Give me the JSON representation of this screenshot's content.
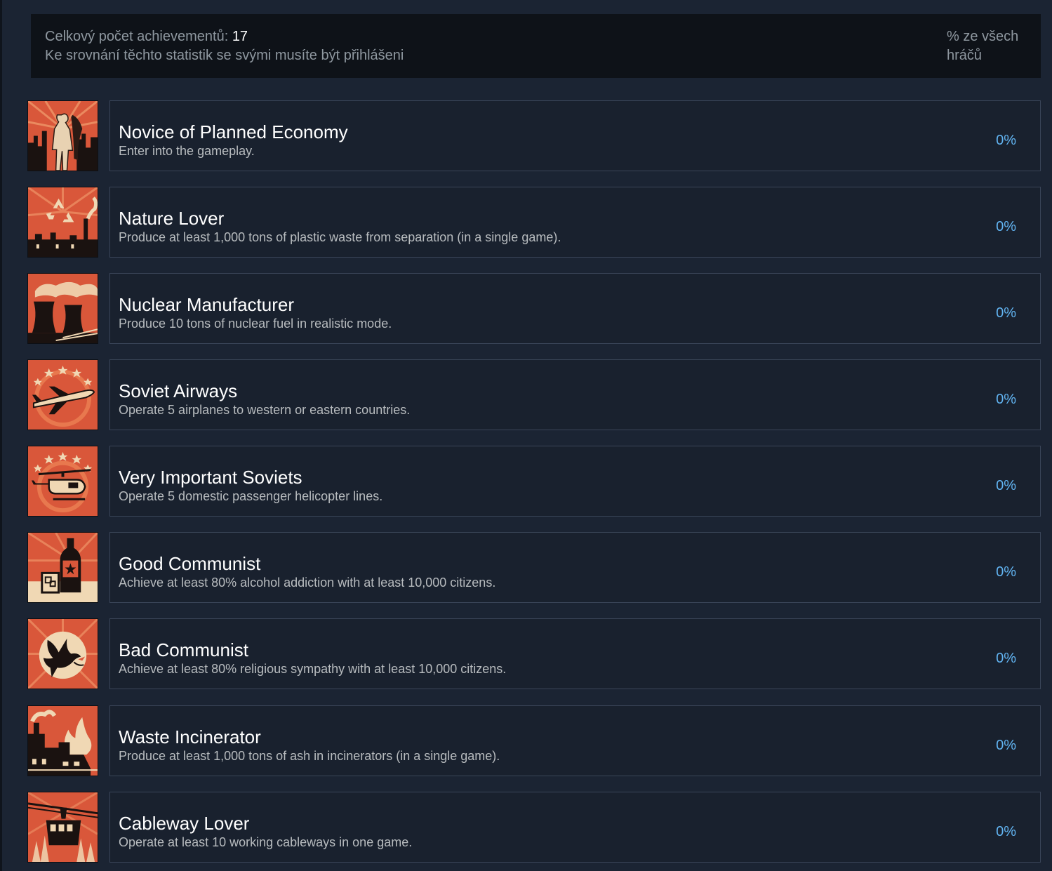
{
  "header": {
    "total_label": "Celkový počet achievementů:",
    "total_count": "17",
    "login_note": "Ke srovnání těchto statistik se svými musíte být přihlášeni",
    "percent_label_1": "% ze všech",
    "percent_label_2": "hráčů"
  },
  "colors": {
    "background": "#1b2433",
    "header_bg": "#0e1218",
    "panel_border": "#3a4558",
    "percent_text": "#62b5f3",
    "icon_orange": "#d9573a",
    "icon_cream": "#f0d8b4"
  },
  "achievements": [
    {
      "title": "Novice of Planned Economy",
      "description": "Enter into the gameplay.",
      "percent": "0%",
      "icon": "worker-flag-icon"
    },
    {
      "title": "Nature Lover",
      "description": "Produce at least 1,000 tons of plastic waste from separation (in a single game).",
      "percent": "0%",
      "icon": "recycle-factory-icon"
    },
    {
      "title": "Nuclear Manufacturer",
      "description": "Produce 10 tons of nuclear fuel in realistic mode.",
      "percent": "0%",
      "icon": "cooling-tower-icon"
    },
    {
      "title": "Soviet Airways",
      "description": "Operate 5 airplanes to western or eastern countries.",
      "percent": "0%",
      "icon": "airplane-icon"
    },
    {
      "title": "Very Important Soviets",
      "description": "Operate 5 domestic passenger helicopter lines.",
      "percent": "0%",
      "icon": "helicopter-icon"
    },
    {
      "title": "Good Communist",
      "description": "Achieve at least 80% alcohol addiction with at least 10,000 citizens.",
      "percent": "0%",
      "icon": "vodka-bottle-icon"
    },
    {
      "title": "Bad Communist",
      "description": "Achieve at least 80% religious sympathy with at least 10,000 citizens.",
      "percent": "0%",
      "icon": "dove-icon"
    },
    {
      "title": "Waste Incinerator",
      "description": "Produce at least 1,000 tons of ash in incinerators (in a single game).",
      "percent": "0%",
      "icon": "incinerator-flame-icon"
    },
    {
      "title": "Cableway Lover",
      "description": "Operate at least 10 working cableways in one game.",
      "percent": "0%",
      "icon": "cable-car-icon"
    }
  ]
}
